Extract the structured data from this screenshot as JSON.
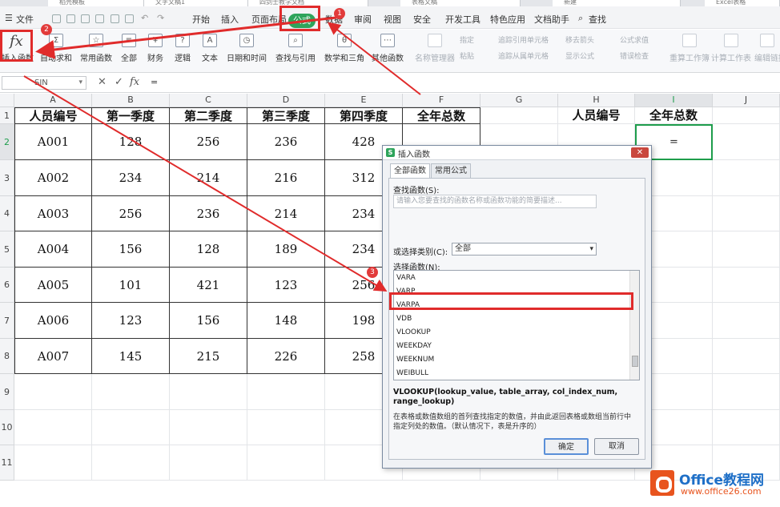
{
  "tabs": [
    "稻壳模板",
    "文字文稿1",
    "四剑士教学文档",
    "表格文稿",
    "新建",
    "Excel表格"
  ],
  "menu": {
    "file": "文件",
    "items": [
      "开始",
      "插入",
      "页面布局",
      "公式",
      "数据",
      "审阅",
      "视图",
      "安全",
      "开发工具",
      "特色应用",
      "文档助手",
      "查找"
    ],
    "active": "公式"
  },
  "ribbon": {
    "fx_symbol": "fx",
    "insert_fn": "插入函数",
    "groups": [
      "自动求和",
      "常用函数",
      "全部",
      "财务",
      "逻辑",
      "文本",
      "日期和时间",
      "查找与引用",
      "数学和三角",
      "其他函数"
    ],
    "dim_items": [
      "名称管理器",
      "指定",
      "粘贴",
      "追踪引用单元格",
      "追踪从属单元格",
      "移去箭头",
      "显示公式",
      "公式求值",
      "错误检查",
      "重算工作簿",
      "计算工作表",
      "编辑链接"
    ]
  },
  "formula_bar": {
    "name": "SIN",
    "value": "="
  },
  "columns": [
    "A",
    "B",
    "C",
    "D",
    "E",
    "F",
    "G",
    "H",
    "I",
    "J"
  ],
  "rows": [
    "1",
    "2",
    "3",
    "4",
    "5",
    "6",
    "7",
    "8",
    "9",
    "10",
    "11"
  ],
  "table": {
    "headers": [
      "人员编号",
      "第一季度",
      "第二季度",
      "第三季度",
      "第四季度",
      "全年总数"
    ],
    "rows": [
      [
        "A001",
        "128",
        "256",
        "236",
        "428"
      ],
      [
        "A002",
        "234",
        "214",
        "216",
        "312"
      ],
      [
        "A003",
        "256",
        "236",
        "214",
        "234"
      ],
      [
        "A004",
        "156",
        "128",
        "189",
        "234"
      ],
      [
        "A005",
        "101",
        "421",
        "123",
        "256"
      ],
      [
        "A006",
        "123",
        "156",
        "148",
        "198"
      ],
      [
        "A007",
        "145",
        "215",
        "226",
        "258"
      ]
    ]
  },
  "side": {
    "h1": "人员编号",
    "i1": "全年总数",
    "i2": "="
  },
  "dialog": {
    "title": "插入函数",
    "close": "✕",
    "tab_all": "全部函数",
    "tab_common": "常用公式",
    "search_label": "查找函数(S):",
    "search_placeholder": "请输入您要查找的函数名称或函数功能的简要描述...",
    "category_label": "或选择类别(C):",
    "category_value": "全部",
    "list_label": "选择函数(N):",
    "functions": [
      "VARA",
      "VARP",
      "VARPA",
      "VDB",
      "VLOOKUP",
      "WEEKDAY",
      "WEEKNUM",
      "WEIBULL"
    ],
    "selected": "VLOOKUP",
    "signature": "VLOOKUP(lookup_value, table_array, col_index_num, range_lookup)",
    "description": "在表格或数值数组的首列查找指定的数值，并由此返回表格或数组当前行中指定列处的数值。（默认情况下，表是升序的）",
    "ok": "确定",
    "cancel": "取消"
  },
  "badges": [
    "1",
    "2",
    "3"
  ],
  "watermark": {
    "brand": "Office教程网",
    "url": "www.office26.com"
  },
  "colors": {
    "accent": "#2ea45b",
    "annotation": "#e02b2b"
  }
}
